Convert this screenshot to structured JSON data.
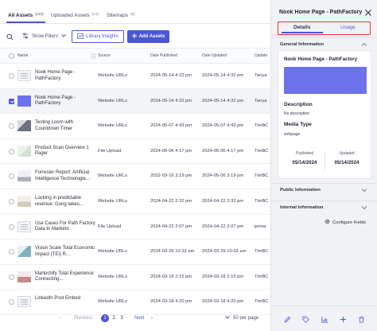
{
  "tabs": [
    {
      "label": "All Assets",
      "count": "(112)"
    },
    {
      "label": "Uploaded Assets",
      "count": "(14)"
    },
    {
      "label": "Sitemaps",
      "count": "(8)"
    }
  ],
  "toolbar": {
    "filters_label": "Show Filters",
    "insights_label": "Library Insights",
    "add_label": "Add Assets"
  },
  "table": {
    "headers": {
      "name": "Name",
      "source": "Source",
      "published": "Date Published",
      "updated": "Date Updated",
      "updated_by": "Update"
    },
    "rows": [
      {
        "name": "Nook Home Page - PathFactory",
        "source": "Website URLs",
        "published": "2024-05-14 4:32 pm",
        "updated": "2024-05-14 4:32 pm",
        "by": "Tanya",
        "thumb": "doc",
        "checked": false
      },
      {
        "name": "Nook Home Page - PathFactory",
        "source": "Website URLs",
        "published": "2024-05-14 4:32 pm",
        "updated": "2024-05-14 4:32 pm",
        "by": "Tanya",
        "thumb": "blue",
        "checked": true
      },
      {
        "name": "Testing Loom with Countdown Timer",
        "source": "Website URLs",
        "published": "2024-05-07 4:43 pm",
        "updated": "2024-05-07 4:43 pm",
        "by": "TimBC",
        "thumb": "dark",
        "checked": false
      },
      {
        "name": "Product Scan Overview 1 Pager",
        "source": "File Upload",
        "published": "2024-05-06 4:17 pm",
        "updated": "2024-05-06 4:17 pm",
        "by": "TimBC",
        "thumb": "green",
        "checked": false
      },
      {
        "name": "Forrester Report: Artificial Intelligence Technologie...",
        "source": "Website URLs",
        "published": "2022-03-16 3:19 pm",
        "updated": "2024-05-06 3:19 pm",
        "by": "TimBC",
        "thumb": "grey",
        "checked": false
      },
      {
        "name": "Locking in predictable revenue: Gong takes...",
        "source": "Website URLs",
        "published": "2024-04-22 2:32 pm",
        "updated": "2024-04-22 2:32 pm",
        "by": "TimBC",
        "thumb": "tan",
        "checked": false
      },
      {
        "name": "Use Cases For Path Factory Data In Marketo",
        "source": "File Upload",
        "published": "2024-04-22 2:07 pm",
        "updated": "2024-04-22 2:07 pm",
        "by": "jenna",
        "thumb": "doc",
        "checked": false
      },
      {
        "name": "Vision Scale Total Economic Impact (TEI) R...",
        "source": "Website URLs",
        "published": "2024-03-29 10:33 am",
        "updated": "2024-03-29 10:33 am",
        "by": "TimBC",
        "thumb": "teal",
        "checked": false
      },
      {
        "name": "Martechify Total Experience: Connecting...",
        "source": "Website URLs",
        "published": "2024-03-18 2:15 pm",
        "updated": "2024-03-18 2:15 pm",
        "by": "TimBC",
        "thumb": "red",
        "checked": false
      },
      {
        "name": "LinkedIn Post Embed",
        "source": "Website URLs",
        "published": "2024-03-18 4:20 pm",
        "updated": "2024-03-18 4:20 pm",
        "by": "TimBC",
        "thumb": "doc",
        "checked": false
      }
    ]
  },
  "pager": {
    "previous": "Previous",
    "pages": [
      "1",
      "2",
      "3"
    ],
    "next": "Next",
    "per_page": "50 per page"
  },
  "panel": {
    "title": "Nook Home Page - PathFactory",
    "tabs": [
      "Details",
      "Usage"
    ],
    "general_heading": "General Information",
    "card_title": "Nook Home Page - PathFactory",
    "description_label": "Description",
    "description_value": "No description",
    "media_type_label": "Media Type",
    "media_type_value": "webpage",
    "published_label": "Published",
    "published_value": "05/14/2024",
    "updated_label": "Updated",
    "updated_value": "05/14/2024",
    "public_heading": "Public Information",
    "internal_heading": "Internal Information",
    "configure_label": "Configure Fields"
  },
  "colors": {
    "accent": "#4a56d6",
    "highlight_border": "#e8352c",
    "thumb_blue": "#6b72ea",
    "panel_bg": "#f1f2f6"
  }
}
